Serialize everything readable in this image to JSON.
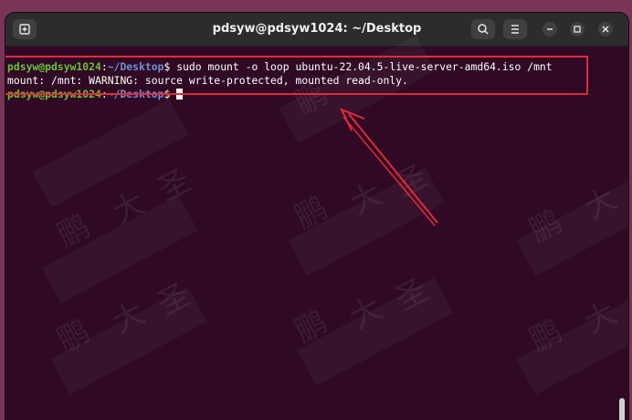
{
  "window": {
    "title": "pdsyw@pdsyw1024: ~/Desktop"
  },
  "titlebar": {
    "new_tab_icon": "new-tab-icon",
    "search_icon": "search-icon",
    "menu_icon": "hamburger-menu-icon",
    "minimize_icon": "minimize-icon",
    "maximize_icon": "maximize-icon",
    "close_icon": "close-icon"
  },
  "terminal": {
    "line1": {
      "user_host": "pdsyw@pdsyw1024",
      "colon": ":",
      "path": "~/Desktop",
      "prompt": "$ ",
      "command": "sudo mount -o loop ubuntu-22.04.5-live-server-amd64.iso /mnt"
    },
    "line2": {
      "output": "mount: /mnt: WARNING: source write-protected, mounted read-only."
    },
    "line3": {
      "user_host": "pdsyw@pdsyw1024",
      "colon": ":",
      "path": "~/Desktop",
      "prompt": "$ "
    }
  },
  "watermark": {
    "chars": [
      "鹏",
      "大",
      "圣"
    ]
  },
  "colors": {
    "terminal_bg": "#300a24",
    "user_host": "#6bbf3a",
    "path": "#6f8fd6",
    "annotation": "#e02a3a"
  }
}
